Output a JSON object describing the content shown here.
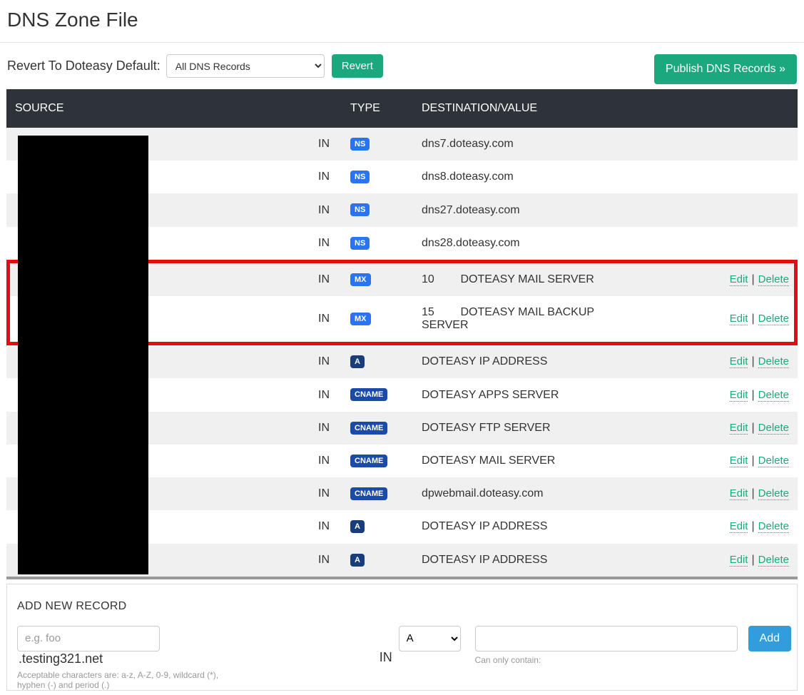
{
  "page": {
    "title": "DNS Zone File"
  },
  "top": {
    "revert_label": "Revert To Doteasy Default:",
    "filter_selected": "All DNS Records",
    "revert_btn": "Revert",
    "publish_btn": "Publish DNS Records »"
  },
  "table": {
    "headers": {
      "source": "SOURCE",
      "type": "TYPE",
      "value": "DESTINATION/VALUE"
    },
    "in_text": "IN",
    "actions": {
      "edit": "Edit",
      "delete": "Delete"
    },
    "rows": [
      {
        "type": "NS",
        "value": "dns7.doteasy.com",
        "has_actions": false,
        "highlight": false,
        "odd": true
      },
      {
        "type": "NS",
        "value": "dns8.doteasy.com",
        "has_actions": false,
        "highlight": false,
        "odd": false
      },
      {
        "type": "NS",
        "value": "dns27.doteasy.com",
        "has_actions": false,
        "highlight": false,
        "odd": true
      },
      {
        "type": "NS",
        "value": "dns28.doteasy.com",
        "has_actions": false,
        "highlight": false,
        "odd": false
      },
      {
        "type": "MX",
        "priority": "10",
        "value": "DOTEASY MAIL SERVER",
        "has_actions": true,
        "highlight": true,
        "odd": true
      },
      {
        "type": "MX",
        "priority": "15",
        "value": "DOTEASY MAIL BACKUP SERVER",
        "has_actions": true,
        "highlight": true,
        "odd": false
      },
      {
        "type": "A",
        "value": "DOTEASY IP ADDRESS",
        "has_actions": true,
        "highlight": false,
        "odd": true
      },
      {
        "type": "CNAME",
        "value": "DOTEASY APPS SERVER",
        "has_actions": true,
        "highlight": false,
        "odd": false
      },
      {
        "type": "CNAME",
        "value": "DOTEASY FTP SERVER",
        "has_actions": true,
        "highlight": false,
        "odd": true
      },
      {
        "type": "CNAME",
        "value": "DOTEASY MAIL SERVER",
        "has_actions": true,
        "highlight": false,
        "odd": false
      },
      {
        "type": "CNAME",
        "value": "dpwebmail.doteasy.com",
        "has_actions": true,
        "highlight": false,
        "odd": true
      },
      {
        "type": "A",
        "value": "DOTEASY IP ADDRESS",
        "has_actions": true,
        "highlight": false,
        "odd": false
      },
      {
        "type": "A",
        "value": "DOTEASY IP ADDRESS",
        "has_actions": true,
        "highlight": false,
        "odd": true
      }
    ]
  },
  "add": {
    "title": "ADD NEW RECORD",
    "subdomain_placeholder": "e.g. foo",
    "domain_suffix": ".testing321.net",
    "in_text": "IN",
    "type_selected": "A",
    "value_placeholder": "",
    "add_btn": "Add",
    "subdomain_hint": "Acceptable characters are: a-z, A-Z, 0-9, wildcard (*), hyphen (-) and period (.)",
    "value_hint": "Can only contain:"
  },
  "colors": {
    "green": "#1ba87e",
    "highlight": "#e20d0d"
  }
}
